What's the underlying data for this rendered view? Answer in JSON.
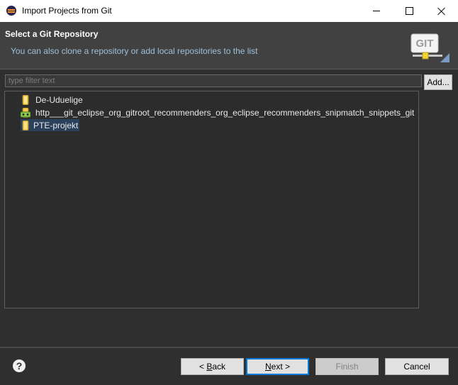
{
  "window": {
    "title": "Import Projects from Git",
    "icon": "eclipse-icon"
  },
  "header": {
    "title": "Select a Git Repository",
    "description": "You can also clone a repository or add local repositories to the list",
    "banner_text": "GIT"
  },
  "filter": {
    "placeholder": "type filter text",
    "value": ""
  },
  "buttons": {
    "add": "Add...",
    "back_mnemonic": "B",
    "back_rest": "ack",
    "back_prefix": "< ",
    "next_mnemonic": "N",
    "next_rest": "ext >",
    "finish": "Finish",
    "cancel": "Cancel"
  },
  "repositories": [
    {
      "label": "De-Uduelige",
      "icon": "repository-icon",
      "selected": false
    },
    {
      "label": "http___git_eclipse_org_gitroot_recommenders_org_eclipse_recommenders_snipmatch_snippets_git",
      "icon": "remote-repository-icon",
      "selected": false
    },
    {
      "label": "PTE-projekt",
      "icon": "repository-icon",
      "selected": true
    }
  ],
  "colors": {
    "selection": "#2b405a",
    "description": "#9ec0da",
    "default_button_border": "#0078d7"
  }
}
